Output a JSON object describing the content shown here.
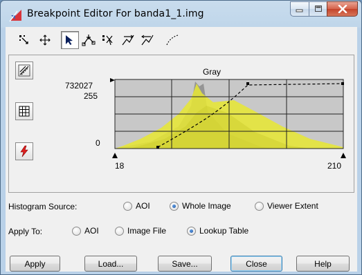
{
  "window": {
    "title": "Breakpoint Editor For banda1_1.img"
  },
  "toolbar": {
    "tools": [
      "zoom-fit-icon",
      "pan-icon",
      "select-arrow-icon",
      "add-point-icon",
      "delete-point-icon",
      "curve-tool-icon",
      "curve-tool-2-icon",
      "dashed-curve-icon"
    ],
    "active_tool": "select-arrow-icon"
  },
  "histogram": {
    "band_label": "Gray",
    "y_max_label": "732027",
    "y_255_label": "255",
    "y_zero_label": "0",
    "x_min_label": "18",
    "x_max_label": "210",
    "colors": {
      "histogram": "#e6e636",
      "plot_bg": "#c8c8c8",
      "grid": "#202020",
      "gray_peak": "#8c8c8c"
    }
  },
  "histogram_source": {
    "label": "Histogram Source:",
    "options": [
      "AOI",
      "Whole Image",
      "Viewer Extent"
    ],
    "selected": "Whole Image"
  },
  "apply_to": {
    "label": "Apply To:",
    "options": [
      "AOI",
      "Image File",
      "Lookup Table"
    ],
    "selected": "Lookup Table"
  },
  "buttons": {
    "apply": "Apply",
    "load": "Load...",
    "save": "Save...",
    "close": "Close",
    "help": "Help"
  }
}
